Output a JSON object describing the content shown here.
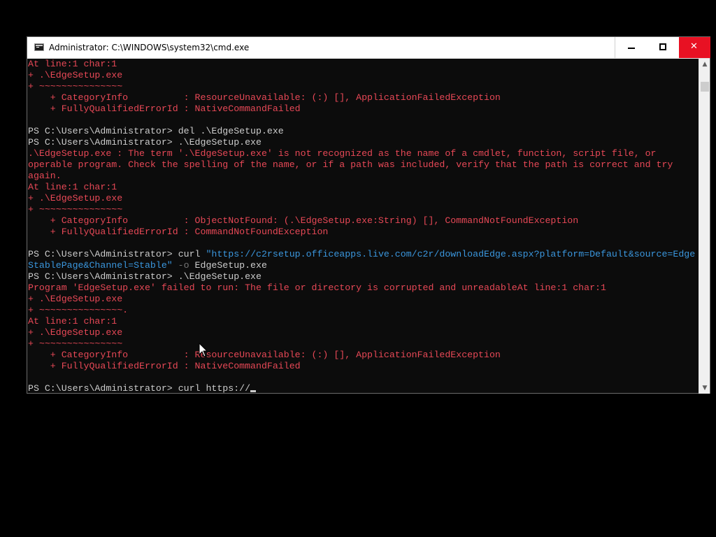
{
  "window": {
    "title": "Administrator: C:\\WINDOWS\\system32\\cmd.exe",
    "minimize_label": "",
    "maximize_label": "",
    "close_label": "✕"
  },
  "colors": {
    "console_bg": "#0c0c0c",
    "default_text": "#cccccc",
    "error_text": "#e74856",
    "string_text": "#3a96dd",
    "parameter_text": "#767676",
    "close_button": "#e81123"
  },
  "console": {
    "lines": [
      {
        "type": "error",
        "text": "At line:1 char:1"
      },
      {
        "type": "error",
        "text": "+ .\\EdgeSetup.exe"
      },
      {
        "type": "error",
        "text": "+ ~~~~~~~~~~~~~~~"
      },
      {
        "type": "error",
        "text": "    + CategoryInfo          : ResourceUnavailable: (:) [], ApplicationFailedException"
      },
      {
        "type": "error",
        "text": "    + FullyQualifiedErrorId : NativeCommandFailed"
      },
      {
        "type": "blank",
        "text": ""
      },
      {
        "type": "prompt",
        "prompt": "PS C:\\Users\\Administrator> ",
        "command": "del .\\EdgeSetup.exe"
      },
      {
        "type": "prompt",
        "prompt": "PS C:\\Users\\Administrator> ",
        "command": ".\\EdgeSetup.exe"
      },
      {
        "type": "error",
        "text": ".\\EdgeSetup.exe : The term '.\\EdgeSetup.exe' is not recognized as the name of a cmdlet, function, script file, or"
      },
      {
        "type": "error",
        "text": "operable program. Check the spelling of the name, or if a path was included, verify that the path is correct and try"
      },
      {
        "type": "error",
        "text": "again."
      },
      {
        "type": "error",
        "text": "At line:1 char:1"
      },
      {
        "type": "error",
        "text": "+ .\\EdgeSetup.exe"
      },
      {
        "type": "error",
        "text": "+ ~~~~~~~~~~~~~~~"
      },
      {
        "type": "error",
        "text": "    + CategoryInfo          : ObjectNotFound: (.\\EdgeSetup.exe:String) [], CommandNotFoundException"
      },
      {
        "type": "error",
        "text": "    + FullyQualifiedErrorId : CommandNotFoundException"
      },
      {
        "type": "blank",
        "text": ""
      },
      {
        "type": "prompt-string",
        "prompt": "PS C:\\Users\\Administrator> ",
        "command": "curl ",
        "string": "\"https://c2rsetup.officeapps.live.com/c2r/downloadEdge.aspx?platform=Default&source=Edge"
      },
      {
        "type": "string-cont",
        "string": "StablePage&Channel=Stable\"",
        "param": " -o",
        "rest": " EdgeSetup.exe"
      },
      {
        "type": "prompt",
        "prompt": "PS C:\\Users\\Administrator> ",
        "command": ".\\EdgeSetup.exe"
      },
      {
        "type": "error",
        "text": "Program 'EdgeSetup.exe' failed to run: The file or directory is corrupted and unreadableAt line:1 char:1"
      },
      {
        "type": "error",
        "text": "+ .\\EdgeSetup.exe"
      },
      {
        "type": "error",
        "text": "+ ~~~~~~~~~~~~~~~."
      },
      {
        "type": "error",
        "text": "At line:1 char:1"
      },
      {
        "type": "error",
        "text": "+ .\\EdgeSetup.exe"
      },
      {
        "type": "error",
        "text": "+ ~~~~~~~~~~~~~~~"
      },
      {
        "type": "error",
        "text": "    + CategoryInfo          : ResourceUnavailable: (:) [], ApplicationFailedException"
      },
      {
        "type": "error",
        "text": "    + FullyQualifiedErrorId : NativeCommandFailed"
      },
      {
        "type": "blank",
        "text": ""
      },
      {
        "type": "input",
        "prompt": "PS C:\\Users\\Administrator> ",
        "command": "curl https://"
      }
    ]
  },
  "scrollbar": {
    "up_arrow": "▲",
    "down_arrow": "▼"
  }
}
